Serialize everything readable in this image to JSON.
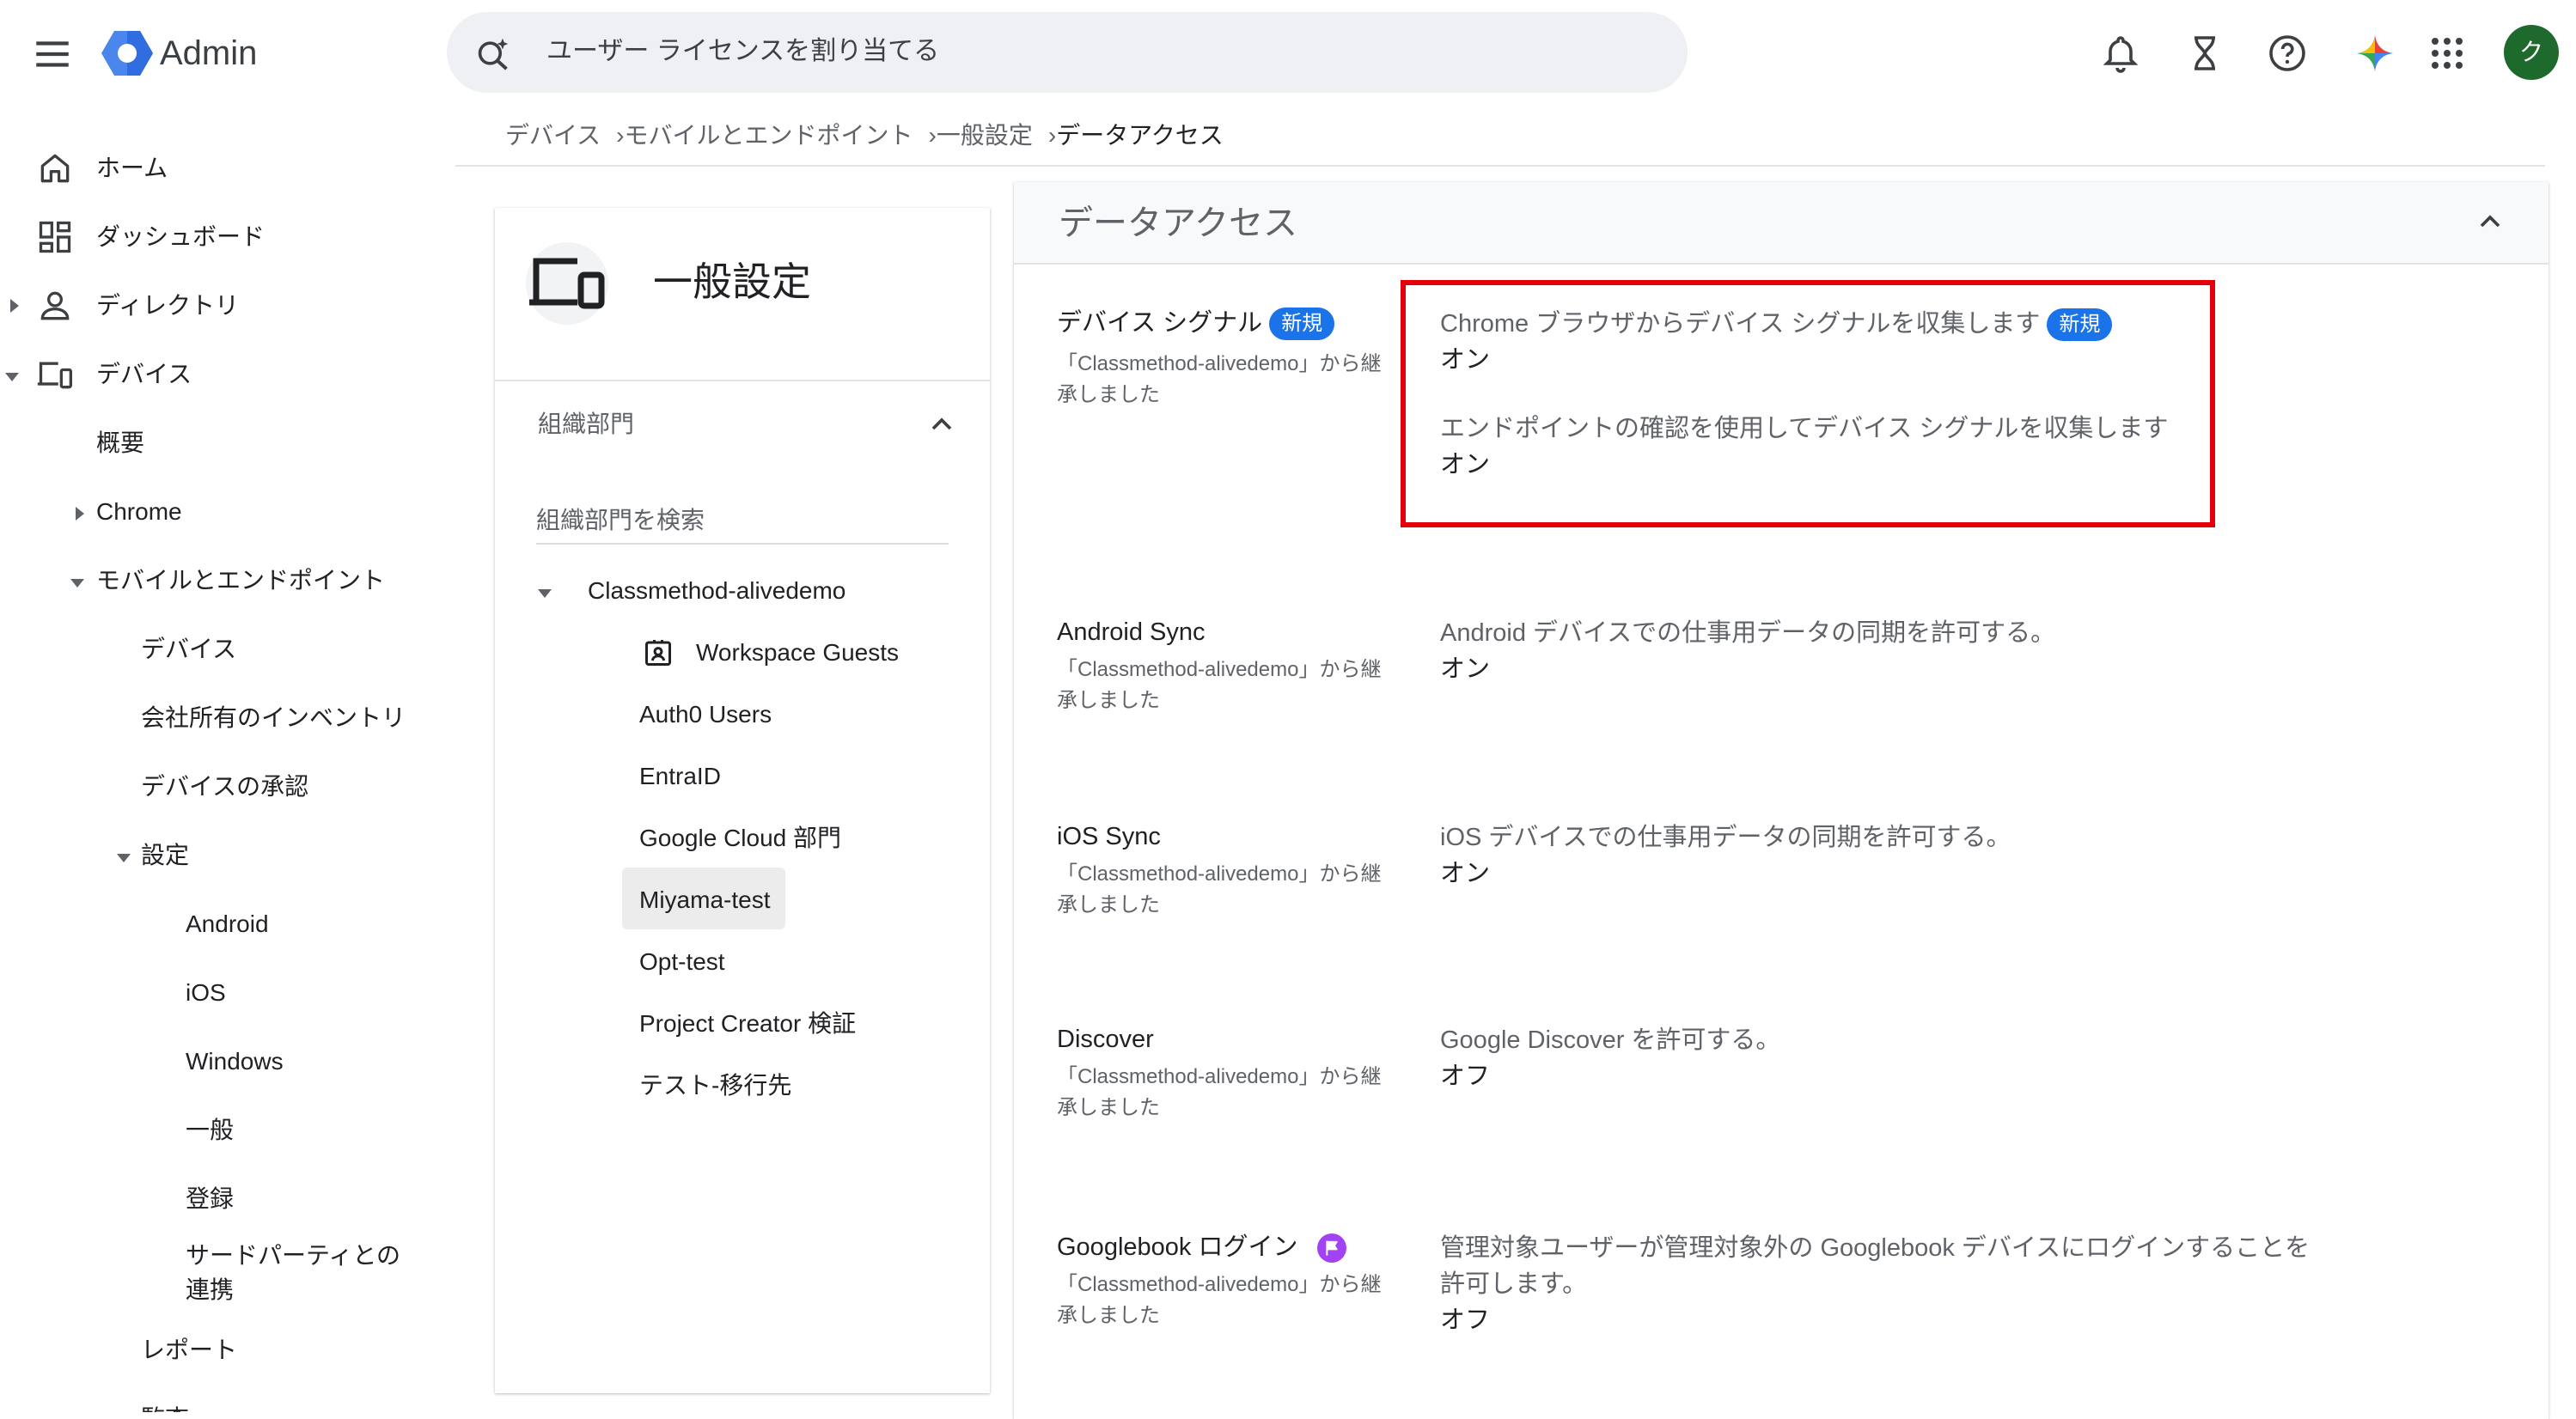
{
  "app": {
    "title": "Admin",
    "avatar_letter": "ク",
    "accent": "#1a73e8",
    "avatar_color": "#1e6a2c"
  },
  "search": {
    "placeholder": "ユーザー ライセンスを割り当てる"
  },
  "topbar_icons": [
    "notifications-icon",
    "hourglass-icon",
    "help-icon",
    "gemini-icon",
    "apps-grid-icon"
  ],
  "sidebar": {
    "items": [
      {
        "label": "ホーム",
        "icon": "home-icon"
      },
      {
        "label": "ダッシュボード",
        "icon": "dashboard-icon"
      },
      {
        "label": "ディレクトリ",
        "icon": "person-icon"
      },
      {
        "label": "デバイス",
        "icon": "devices-icon"
      },
      {
        "label": "概要"
      },
      {
        "label": "Chrome"
      },
      {
        "label": "モバイルとエンドポイント"
      },
      {
        "label": "デバイス"
      },
      {
        "label": "会社所有のインベントリ"
      },
      {
        "label": "デバイスの承認"
      },
      {
        "label": "設定"
      },
      {
        "label": "Android"
      },
      {
        "label": "iOS"
      },
      {
        "label": "Windows"
      },
      {
        "label": "一般"
      },
      {
        "label": "登録"
      },
      {
        "label": "サードパーティとの"
      },
      {
        "label": "連携"
      },
      {
        "label": "レポート"
      },
      {
        "label": "監査"
      }
    ]
  },
  "breadcrumb": {
    "items": [
      "デバイス",
      "モバイルとエンドポイント",
      "一般設定"
    ],
    "separator": "›",
    "current": "データアクセス"
  },
  "ou_panel": {
    "title": "一般設定",
    "section_label": "組織部門",
    "search_label": "組織部門を検索",
    "root": "Classmethod-alivedemo",
    "children": [
      "Workspace Guests",
      "Auth0 Users",
      "EntraID",
      "Google Cloud 部門",
      "Miyama-test",
      "Opt-test",
      "Project Creator 検証",
      "テスト-移行先"
    ],
    "selected": "Miyama-test"
  },
  "data_access": {
    "title": "データアクセス",
    "settings": [
      {
        "title": "デバイス シグナル",
        "badge": "新規",
        "inherit": "「Classmethod-alivedemo」から継承しました",
        "options": [
          {
            "desc": "Chrome ブラウザからデバイス シグナルを収集します",
            "badge": "新規",
            "value": "オン"
          },
          {
            "desc": "エンドポイントの確認を使用してデバイス シグナルを収集します",
            "value": "オン"
          }
        ]
      },
      {
        "title": "Android Sync",
        "inherit": "「Classmethod-alivedemo」から継承しました",
        "desc": "Android デバイスでの仕事用データの同期を許可する。",
        "value": "オン"
      },
      {
        "title": "iOS Sync",
        "inherit": "「Classmethod-alivedemo」から継承しました",
        "desc": "iOS デバイスでの仕事用データの同期を許可する。",
        "value": "オン"
      },
      {
        "title": "Discover",
        "inherit": "「Classmethod-alivedemo」から継承しました",
        "desc": "Google Discover を許可する。",
        "value": "オフ"
      },
      {
        "title": "Googlebook ログイン",
        "icon": "flag-icon",
        "inherit": "「Classmethod-alivedemo」から継承しました",
        "desc": "管理対象ユーザーが管理対象外の Googlebook デバイスにログインすることを許可します。",
        "value": "オフ"
      }
    ]
  },
  "highlight_color": "#e3000b"
}
